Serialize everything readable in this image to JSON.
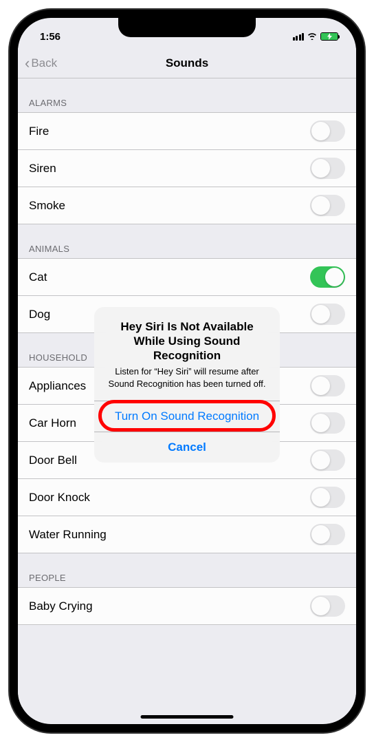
{
  "statusBar": {
    "time": "1:56"
  },
  "nav": {
    "back": "Back",
    "title": "Sounds"
  },
  "sections": [
    {
      "header": "ALARMS",
      "items": [
        {
          "label": "Fire",
          "on": false
        },
        {
          "label": "Siren",
          "on": false
        },
        {
          "label": "Smoke",
          "on": false
        }
      ]
    },
    {
      "header": "ANIMALS",
      "items": [
        {
          "label": "Cat",
          "on": true
        },
        {
          "label": "Dog",
          "on": false
        }
      ]
    },
    {
      "header": "HOUSEHOLD",
      "items": [
        {
          "label": "Appliances",
          "on": false
        },
        {
          "label": "Car Horn",
          "on": false
        },
        {
          "label": "Door Bell",
          "on": false
        },
        {
          "label": "Door Knock",
          "on": false
        },
        {
          "label": "Water Running",
          "on": false
        }
      ]
    },
    {
      "header": "PEOPLE",
      "items": [
        {
          "label": "Baby Crying",
          "on": false
        }
      ]
    }
  ],
  "alert": {
    "title": "Hey Siri Is Not Available While Using Sound Recognition",
    "message": "Listen for “Hey Siri” will resume after Sound Recognition has been turned off.",
    "primary": "Turn On Sound Recognition",
    "cancel": "Cancel"
  }
}
